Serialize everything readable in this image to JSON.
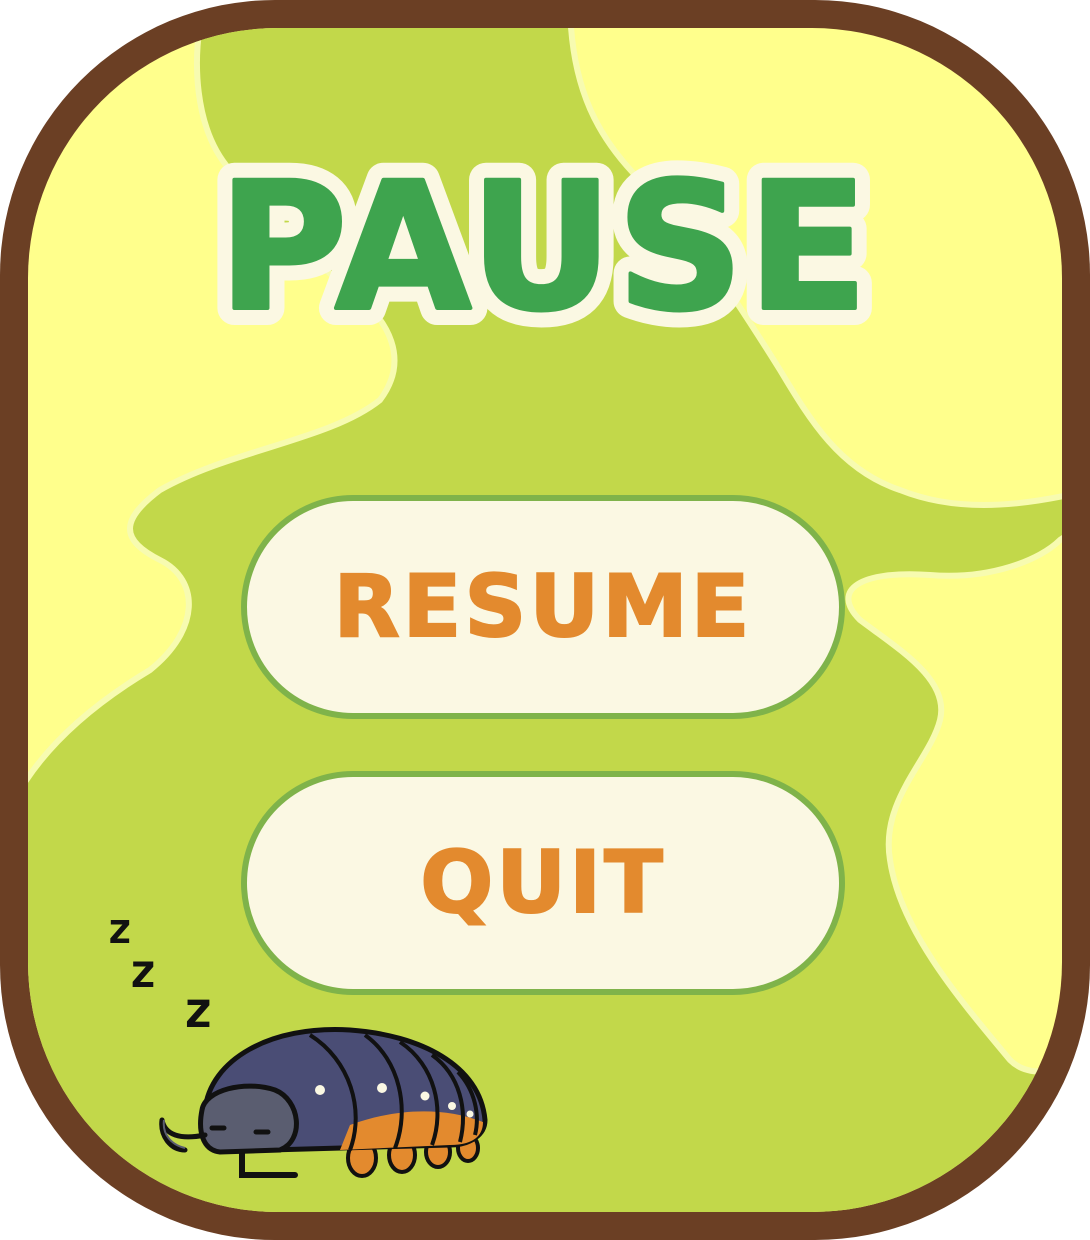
{
  "pause_menu": {
    "title": "PAUSE",
    "resume_label": "RESUME",
    "quit_label": "QUIT",
    "sleep_z": [
      "z",
      "z",
      "z"
    ]
  },
  "colors": {
    "frame_border": "#6b3f24",
    "light_yellow": "#ffff8c",
    "lime_green": "#c2d84a",
    "title_green": "#3ea44e",
    "title_outline": "#fbf8e3",
    "button_fill": "#fbf8e3",
    "button_border": "#7fb34a",
    "button_text": "#e38a2e"
  },
  "icons": {
    "mascot": "sleeping-pillbug-icon",
    "sleep": "zzz-icon"
  }
}
